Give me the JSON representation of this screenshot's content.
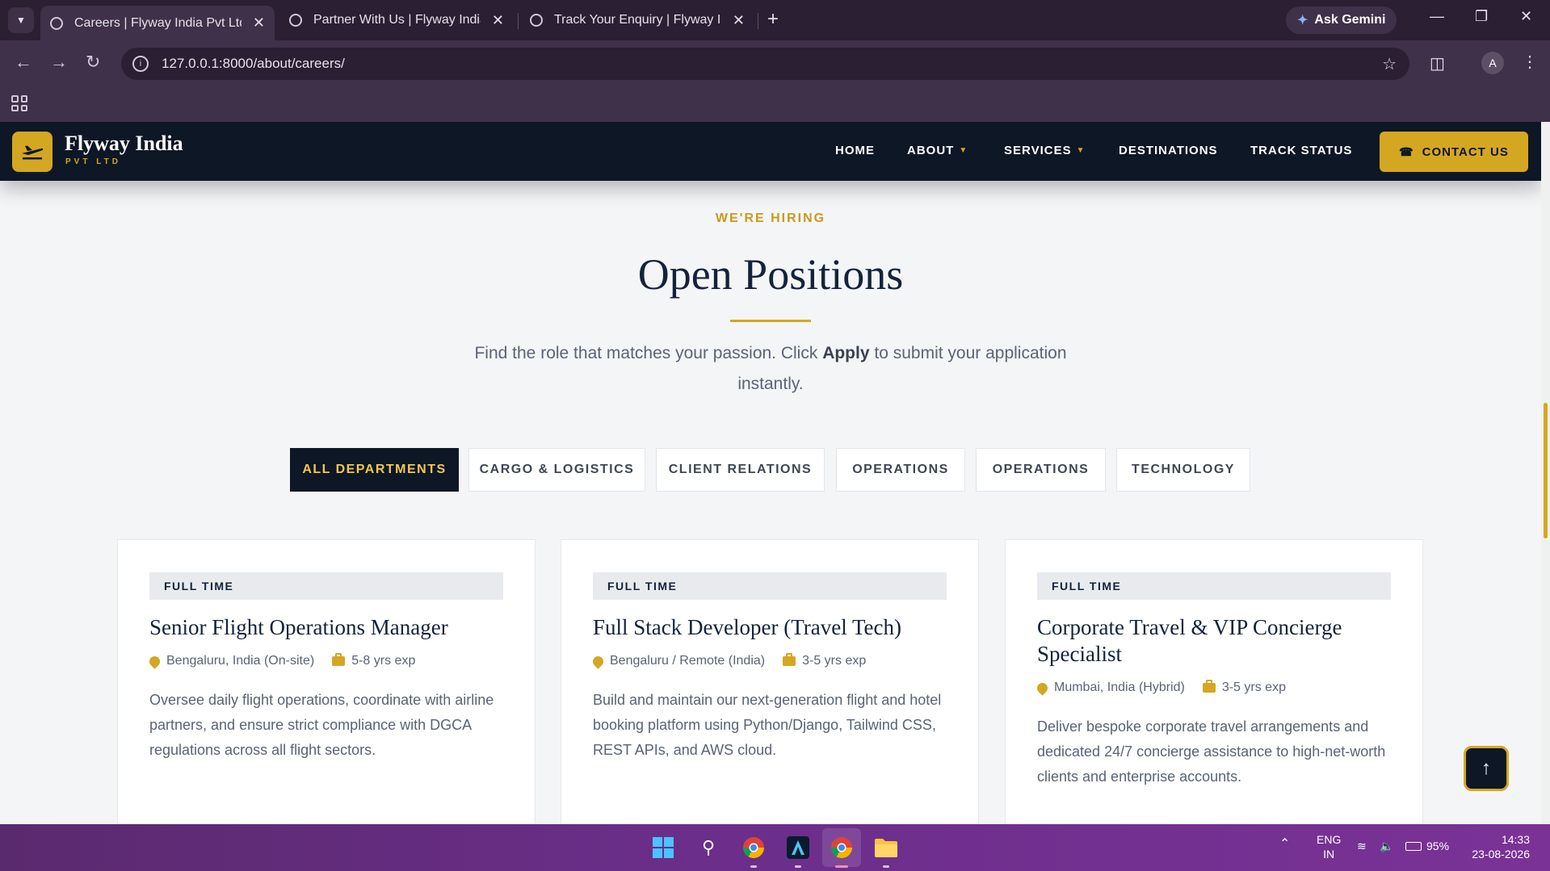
{
  "browser": {
    "tabs": [
      {
        "title": "Careers | Flyway India Pvt Ltd",
        "active": true
      },
      {
        "title": "Partner With Us | Flyway India",
        "active": false
      },
      {
        "title": "Track Your Enquiry | Flyway India",
        "active": false
      }
    ],
    "gemini_label": "Ask Gemini",
    "url": "127.0.0.1:8000/about/careers/",
    "profile_initial": "A"
  },
  "site": {
    "brand_name": "Flyway India",
    "brand_sub": "PVT LTD",
    "nav": [
      {
        "label": "HOME",
        "dropdown": false
      },
      {
        "label": "ABOUT",
        "dropdown": true
      },
      {
        "label": "SERVICES",
        "dropdown": true
      },
      {
        "label": "DESTINATIONS",
        "dropdown": false
      },
      {
        "label": "TRACK STATUS",
        "dropdown": false
      }
    ],
    "contact_label": "CONTACT US",
    "accent": "#d4a722",
    "navy": "#0d1726"
  },
  "section": {
    "eyebrow": "WE'RE HIRING",
    "title": "Open Positions",
    "lead_before": "Find the role that matches your passion. Click ",
    "lead_bold": "Apply",
    "lead_after": " to submit your application instantly."
  },
  "filters": [
    {
      "label": "ALL DEPARTMENTS",
      "active": true
    },
    {
      "label": "CARGO & LOGISTICS",
      "active": false
    },
    {
      "label": "CLIENT RELATIONS",
      "active": false
    },
    {
      "label": "OPERATIONS",
      "active": false
    },
    {
      "label": "OPERATIONS",
      "active": false
    },
    {
      "label": "TECHNOLOGY",
      "active": false
    }
  ],
  "jobs": [
    {
      "type": "FULL TIME",
      "title": "Senior Flight Operations Manager",
      "location": "Bengaluru, India (On-site)",
      "experience": "5-8 yrs exp",
      "description": "Oversee daily flight operations, coordinate with airline partners, and ensure strict compliance with DGCA regulations across all flight sectors."
    },
    {
      "type": "FULL TIME",
      "title": "Full Stack Developer (Travel Tech)",
      "location": "Bengaluru / Remote (India)",
      "experience": "3-5 yrs exp",
      "description": "Build and maintain our next-generation flight and hotel booking platform using Python/Django, Tailwind CSS, REST APIs, and AWS cloud."
    },
    {
      "type": "FULL TIME",
      "title": "Corporate Travel & VIP Concierge Specialist",
      "location": "Mumbai, India (Hybrid)",
      "experience": "3-5 yrs exp",
      "description": "Deliver bespoke corporate travel arrangements and dedicated 24/7 concierge assistance to high-net-worth clients and enterprise accounts."
    }
  ],
  "taskbar": {
    "language": "ENG",
    "region": "IN",
    "battery": "95%",
    "time": "14:33",
    "date": "23-08-2026"
  }
}
